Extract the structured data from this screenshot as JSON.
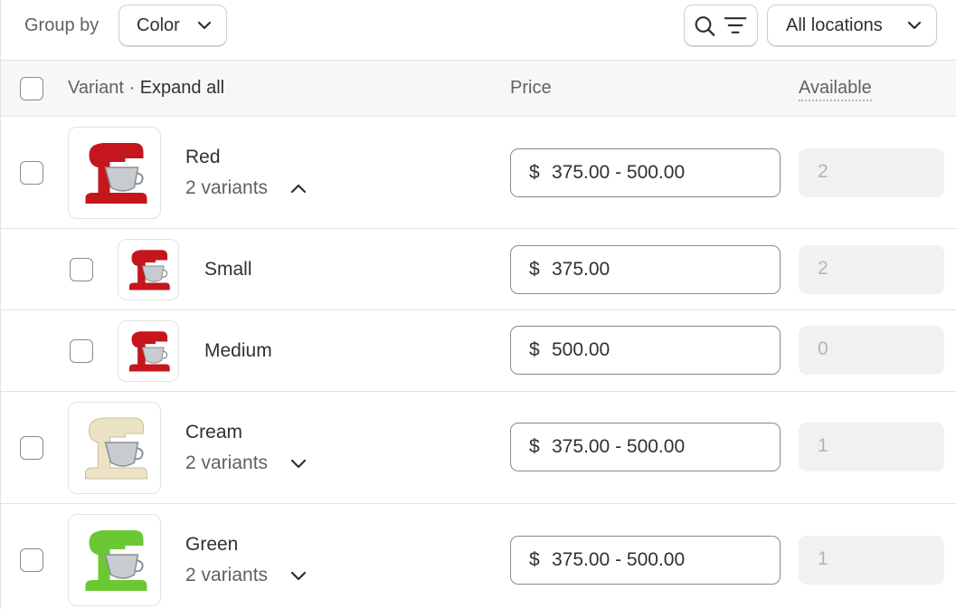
{
  "toolbar": {
    "group_by_label": "Group by",
    "group_by_value": "Color",
    "locations_label": "All locations"
  },
  "table": {
    "headers": {
      "variant": "Variant",
      "separator": "·",
      "expand_all": "Expand all",
      "price": "Price",
      "available": "Available"
    },
    "groups": [
      {
        "name": "Red",
        "variant_count": "2 variants",
        "currency": "$",
        "price": "375.00 - 500.00",
        "available": "2",
        "expanded": true,
        "color": "#c4161c",
        "variants": [
          {
            "name": "Small",
            "currency": "$",
            "price": "375.00",
            "available": "2"
          },
          {
            "name": "Medium",
            "currency": "$",
            "price": "500.00",
            "available": "0"
          }
        ]
      },
      {
        "name": "Cream",
        "variant_count": "2 variants",
        "currency": "$",
        "price": "375.00 - 500.00",
        "available": "1",
        "expanded": false,
        "color": "#ece3c4"
      },
      {
        "name": "Green",
        "variant_count": "2 variants",
        "currency": "$",
        "price": "375.00 - 500.00",
        "available": "1",
        "expanded": false,
        "color": "#6cc832"
      }
    ]
  }
}
